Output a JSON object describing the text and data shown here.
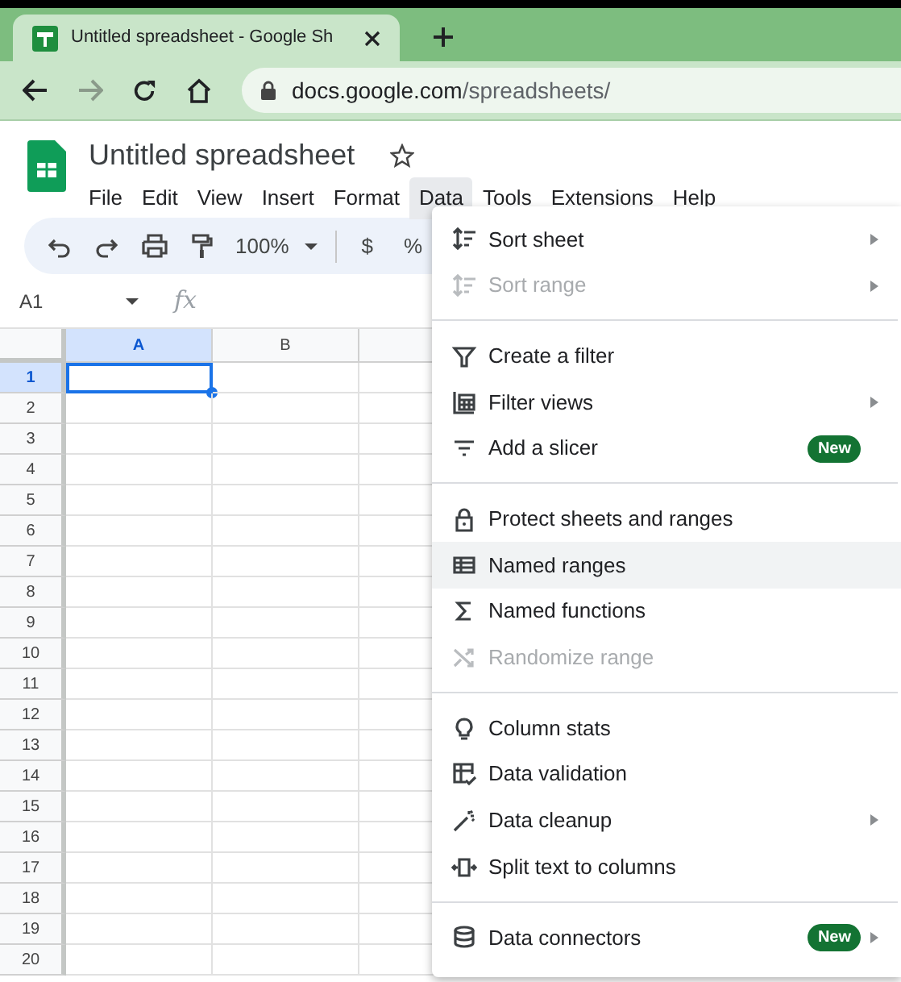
{
  "browser": {
    "tab_title": "Untitled spreadsheet - Google Sh",
    "address": {
      "host": "docs.google.com",
      "path": "/spreadsheets/"
    }
  },
  "document": {
    "title": "Untitled spreadsheet",
    "starred": false
  },
  "menubar": [
    {
      "label": "File",
      "selected": false
    },
    {
      "label": "Edit",
      "selected": false
    },
    {
      "label": "View",
      "selected": false
    },
    {
      "label": "Insert",
      "selected": false
    },
    {
      "label": "Format",
      "selected": false
    },
    {
      "label": "Data",
      "selected": true
    },
    {
      "label": "Tools",
      "selected": false
    },
    {
      "label": "Extensions",
      "selected": false
    },
    {
      "label": "Help",
      "selected": false
    }
  ],
  "toolbar": {
    "zoom": "100%",
    "currency": "$",
    "percent": "%"
  },
  "formula_bar": {
    "cell_ref": "A1",
    "fx": "fx"
  },
  "sheet": {
    "columns": [
      {
        "label": "A",
        "selected": true
      },
      {
        "label": "B",
        "selected": false
      },
      {
        "selected": false
      }
    ],
    "rows": [
      {
        "label": "1",
        "selected": true
      },
      {
        "label": "2",
        "selected": false
      },
      {
        "label": "3",
        "selected": false
      },
      {
        "label": "4",
        "selected": false
      },
      {
        "label": "5",
        "selected": false
      },
      {
        "label": "6",
        "selected": false
      },
      {
        "label": "7",
        "selected": false
      },
      {
        "label": "8",
        "selected": false
      },
      {
        "label": "9",
        "selected": false
      },
      {
        "label": "10",
        "selected": false
      },
      {
        "label": "11",
        "selected": false
      },
      {
        "label": "12",
        "selected": false
      },
      {
        "label": "13",
        "selected": false
      },
      {
        "label": "14",
        "selected": false
      },
      {
        "label": "15",
        "selected": false
      },
      {
        "label": "16",
        "selected": false
      },
      {
        "label": "17",
        "selected": false
      },
      {
        "label": "18",
        "selected": false
      },
      {
        "label": "19",
        "selected": false
      },
      {
        "label": "20",
        "selected": false
      }
    ]
  },
  "data_menu": {
    "items": [
      {
        "kind": "item",
        "label": "Sort sheet",
        "disabled": false,
        "selected": false,
        "submenu": true
      },
      {
        "kind": "item",
        "label": "Sort range",
        "disabled": true,
        "selected": false,
        "submenu": true
      },
      {
        "kind": "divider"
      },
      {
        "kind": "item",
        "label": "Create a filter",
        "disabled": false,
        "selected": false,
        "submenu": false
      },
      {
        "kind": "item",
        "label": "Filter views",
        "disabled": false,
        "selected": false,
        "submenu": true
      },
      {
        "kind": "item",
        "label": "Add a slicer",
        "disabled": false,
        "selected": false,
        "submenu": false,
        "badge": "New"
      },
      {
        "kind": "divider"
      },
      {
        "kind": "item",
        "label": "Protect sheets and ranges",
        "disabled": false,
        "selected": false,
        "submenu": false
      },
      {
        "kind": "item",
        "label": "Named ranges",
        "disabled": false,
        "selected": true,
        "submenu": false
      },
      {
        "kind": "item",
        "label": "Named functions",
        "disabled": false,
        "selected": false,
        "submenu": false
      },
      {
        "kind": "item",
        "label": "Randomize range",
        "disabled": true,
        "selected": false,
        "submenu": false
      },
      {
        "kind": "divider"
      },
      {
        "kind": "item",
        "label": "Column stats",
        "disabled": false,
        "selected": false,
        "submenu": false
      },
      {
        "kind": "item",
        "label": "Data validation",
        "disabled": false,
        "selected": false,
        "submenu": false
      },
      {
        "kind": "item",
        "label": "Data cleanup",
        "disabled": false,
        "selected": false,
        "submenu": true
      },
      {
        "kind": "item",
        "label": "Split text to columns",
        "disabled": false,
        "selected": false,
        "submenu": false
      },
      {
        "kind": "divider"
      },
      {
        "kind": "item",
        "label": "Data connectors",
        "disabled": false,
        "selected": false,
        "submenu": true,
        "badge": "New"
      }
    ]
  }
}
